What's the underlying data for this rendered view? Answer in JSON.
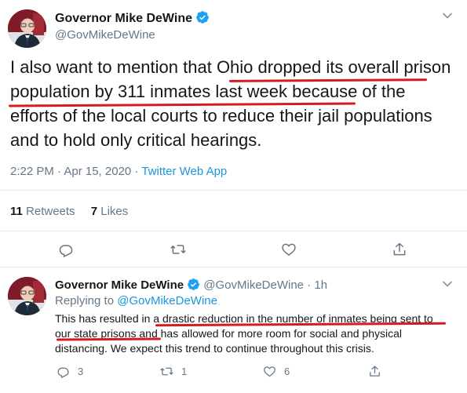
{
  "main_tweet": {
    "display_name": "Governor Mike DeWine",
    "handle": "@GovMikeDeWine",
    "text_parts": [
      "I also want to mention that ",
      "Ohio dropped its overall prison population by 311 inmates last week",
      " because of the efforts of the local courts to reduce their jail populations and to hold only critical hearings."
    ],
    "time": "2:22 PM · Apr 15, 2020",
    "separator": " · ",
    "app": "Twitter Web App",
    "retweets_count": "11",
    "retweets_label": "Retweets",
    "likes_count": "7",
    "likes_label": "Likes",
    "icons": [
      "reply-icon",
      "retweet-icon",
      "like-icon",
      "share-icon",
      "chevron-down-icon",
      "verified-icon"
    ]
  },
  "reply_tweet": {
    "display_name": "Governor Mike DeWine",
    "handle": "@GovMikeDeWine",
    "age": "1h",
    "dot": " · ",
    "replying_label": "Replying to ",
    "replying_to": "@GovMikeDeWine",
    "text_parts": [
      "This has resulted in ",
      "a drastic reduction in the number of inmates being sent to our state prisons",
      " and has allowed for more room for social and physical distancing. We expect this trend to continue throughout this crisis."
    ],
    "reply_count": "3",
    "retweet_count": "1",
    "like_count": "6"
  },
  "colors": {
    "link": "#1b95e0",
    "muted": "#657786",
    "annotation_red": "#d71920",
    "divider": "#e6ecf0"
  }
}
